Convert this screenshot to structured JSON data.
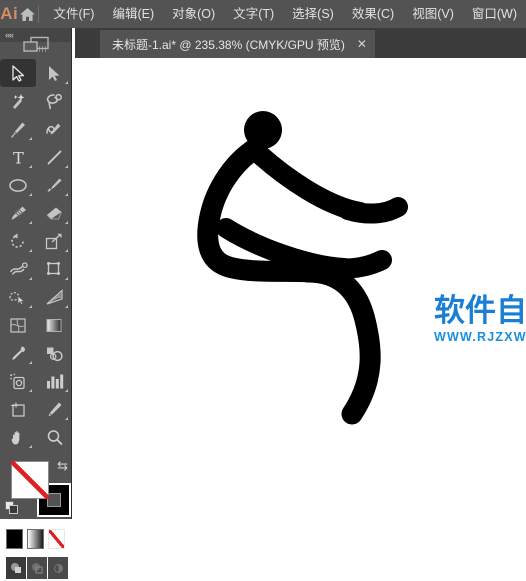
{
  "app": {
    "logo_text": "Ai",
    "home_icon": "home-icon"
  },
  "menubar": {
    "items": [
      {
        "label": "文件(F)",
        "name": "menu-file"
      },
      {
        "label": "编辑(E)",
        "name": "menu-edit"
      },
      {
        "label": "对象(O)",
        "name": "menu-object"
      },
      {
        "label": "文字(T)",
        "name": "menu-type"
      },
      {
        "label": "选择(S)",
        "name": "menu-select"
      },
      {
        "label": "效果(C)",
        "name": "menu-effect"
      },
      {
        "label": "视图(V)",
        "name": "menu-view"
      },
      {
        "label": "窗口(W)",
        "name": "menu-window"
      }
    ]
  },
  "document_tab": {
    "title": "未标题-1.ai* @ 235.38% (CMYK/GPU 预览)",
    "close_label": "✕",
    "zoom_level": "235.38%",
    "color_mode": "CMYK",
    "preview_mode": "GPU 预览",
    "modified": true
  },
  "toolbox": {
    "collapse_label": "««",
    "tools": [
      {
        "name": "selection-tool",
        "active": true,
        "has_flyout": false
      },
      {
        "name": "direct-selection-tool",
        "active": false,
        "has_flyout": true
      },
      {
        "name": "magic-wand-tool",
        "active": false,
        "has_flyout": false
      },
      {
        "name": "lasso-tool",
        "active": false,
        "has_flyout": false
      },
      {
        "name": "pen-tool",
        "active": false,
        "has_flyout": true
      },
      {
        "name": "curvature-tool",
        "active": false,
        "has_flyout": false
      },
      {
        "name": "type-tool",
        "active": false,
        "has_flyout": true
      },
      {
        "name": "line-segment-tool",
        "active": false,
        "has_flyout": true
      },
      {
        "name": "ellipse-tool",
        "active": false,
        "has_flyout": true
      },
      {
        "name": "paintbrush-tool",
        "active": false,
        "has_flyout": true
      },
      {
        "name": "shaper-tool",
        "active": false,
        "has_flyout": true
      },
      {
        "name": "eraser-tool",
        "active": false,
        "has_flyout": true
      },
      {
        "name": "rotate-tool",
        "active": false,
        "has_flyout": true
      },
      {
        "name": "scale-tool",
        "active": false,
        "has_flyout": true
      },
      {
        "name": "width-tool",
        "active": false,
        "has_flyout": true
      },
      {
        "name": "free-transform-tool",
        "active": false,
        "has_flyout": true
      },
      {
        "name": "shape-builder-tool",
        "active": false,
        "has_flyout": true
      },
      {
        "name": "perspective-grid-tool",
        "active": false,
        "has_flyout": true
      },
      {
        "name": "mesh-tool",
        "active": false,
        "has_flyout": false
      },
      {
        "name": "gradient-tool",
        "active": false,
        "has_flyout": false
      },
      {
        "name": "eyedropper-tool",
        "active": false,
        "has_flyout": true
      },
      {
        "name": "blend-tool",
        "active": false,
        "has_flyout": false
      },
      {
        "name": "symbol-sprayer-tool",
        "active": false,
        "has_flyout": true
      },
      {
        "name": "column-graph-tool",
        "active": false,
        "has_flyout": true
      },
      {
        "name": "artboard-tool",
        "active": false,
        "has_flyout": false
      },
      {
        "name": "slice-tool",
        "active": false,
        "has_flyout": true
      },
      {
        "name": "hand-tool",
        "active": false,
        "has_flyout": true
      },
      {
        "name": "zoom-tool",
        "active": false,
        "has_flyout": false
      }
    ],
    "color_controls": {
      "fill": "none",
      "fill_color": "#ffffff",
      "stroke": "solid",
      "stroke_color": "#000000",
      "swap_label": "⇆",
      "mini_buttons": [
        {
          "name": "color-button",
          "selected": false
        },
        {
          "name": "gradient-button",
          "selected": false
        },
        {
          "name": "none-button",
          "selected": true
        }
      ],
      "draw_modes": [
        {
          "name": "draw-normal-button",
          "selected": true
        },
        {
          "name": "draw-behind-button",
          "selected": false
        },
        {
          "name": "draw-inside-button",
          "selected": false
        }
      ],
      "screen_mode": "change-screen-mode-button"
    }
  },
  "canvas": {
    "background_color": "#ffffff",
    "artwork_name": "stick-figure-sitting",
    "artwork_color": "#000000"
  },
  "watermark": {
    "cn_text": "软件自学网",
    "en_text": "WWW.RJZXW.COM",
    "color": "#1a7fd4"
  }
}
